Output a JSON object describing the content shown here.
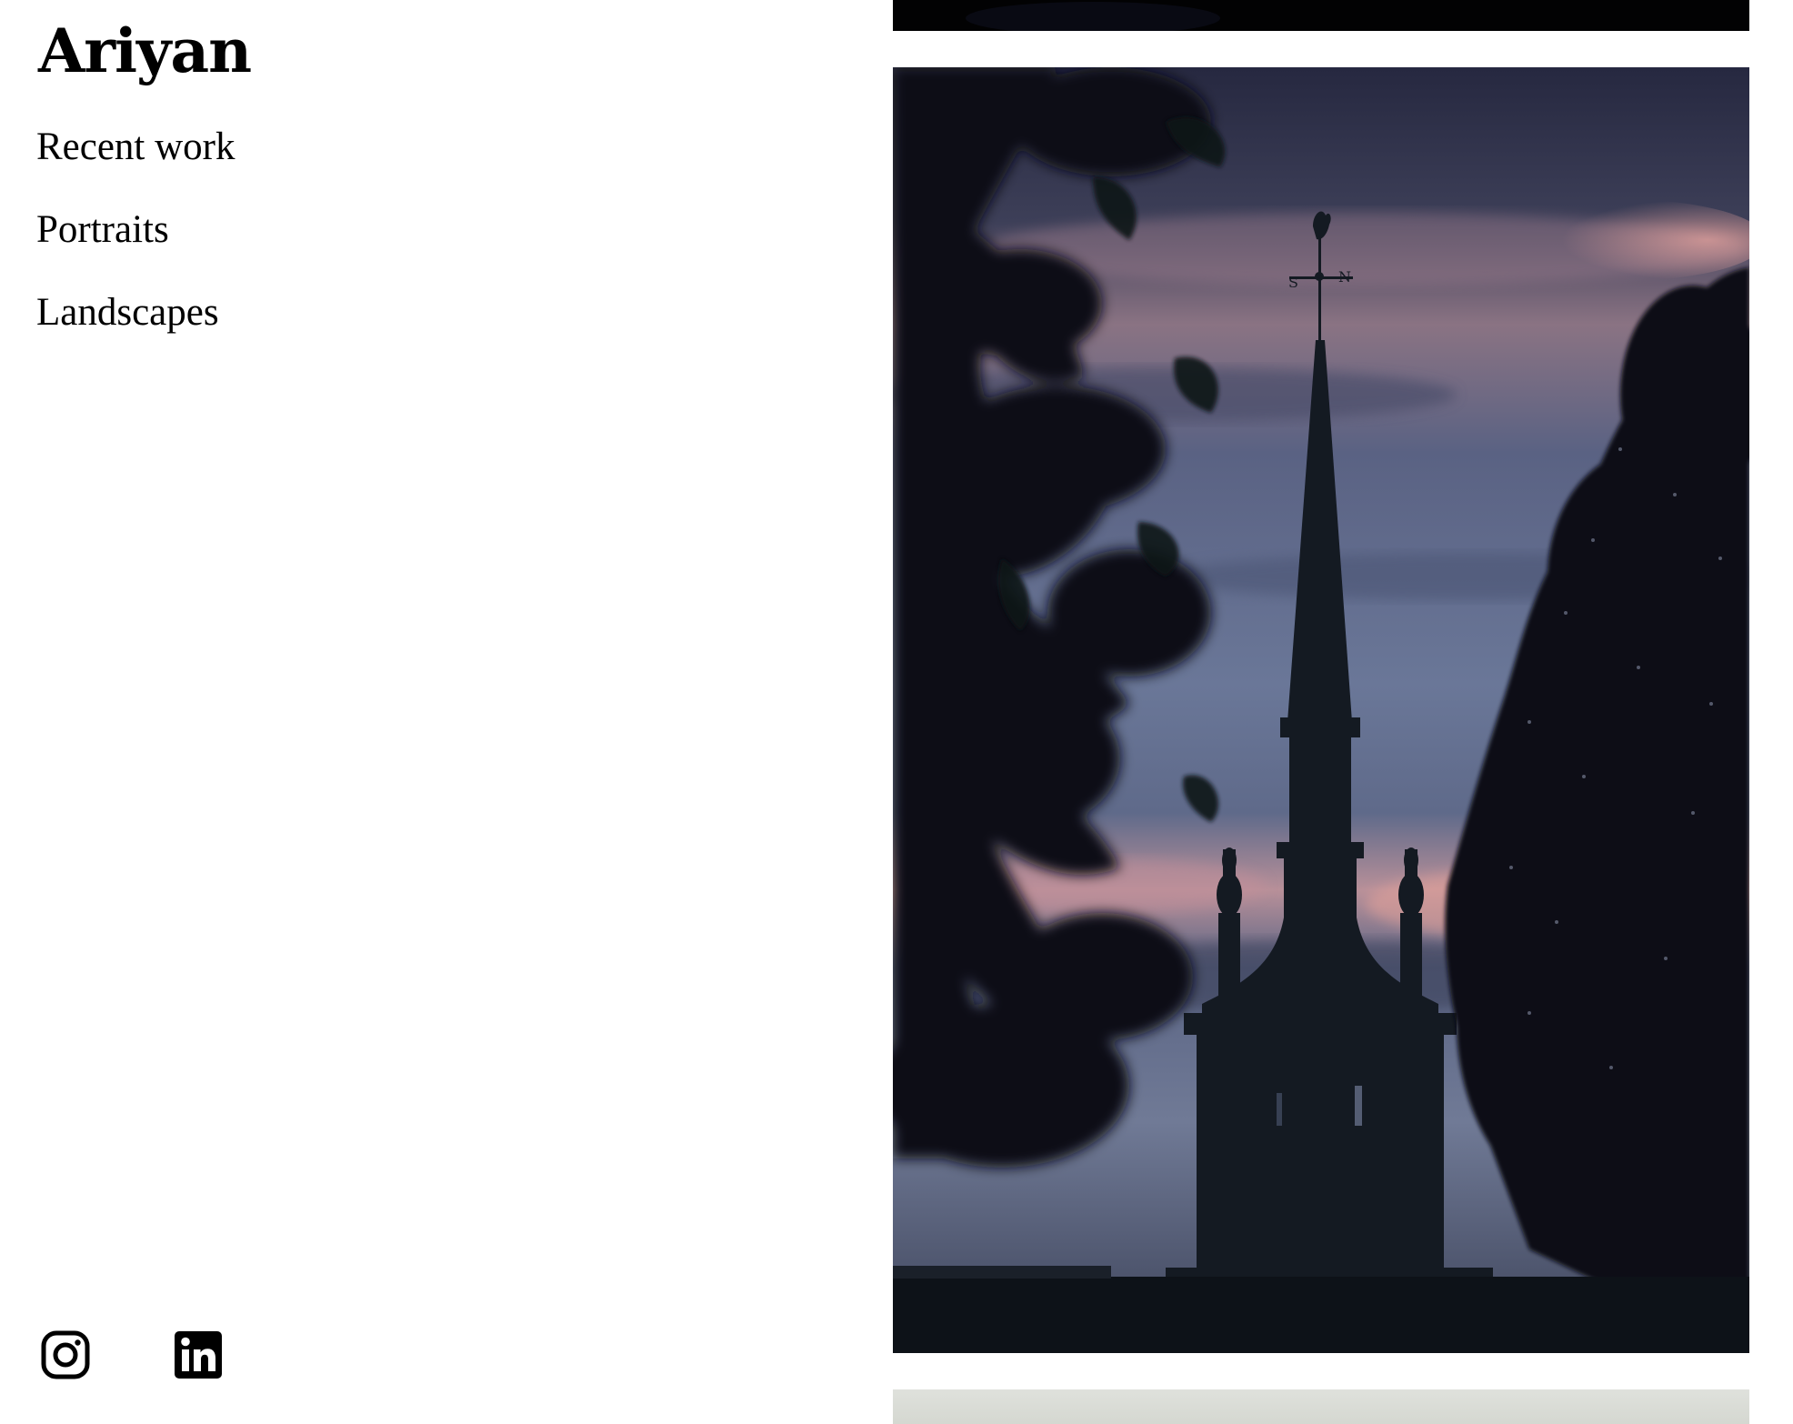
{
  "site": {
    "title": "Ariyan"
  },
  "nav": {
    "items": [
      {
        "label": "Recent work"
      },
      {
        "label": "Portraits"
      },
      {
        "label": "Landscapes"
      }
    ]
  },
  "social": {
    "items": [
      {
        "icon": "instagram-icon"
      },
      {
        "icon": "linkedin-icon"
      }
    ]
  },
  "gallery": {
    "photos": [
      {
        "subject": "dark photo cropped at top"
      },
      {
        "subject": "church spire silhouette at dusk with weathervane and trees",
        "weathervane_letters": [
          "S",
          "N"
        ]
      },
      {
        "subject": "pale grey photo cropped at bottom"
      }
    ]
  },
  "colors": {
    "background": "#ffffff",
    "text": "#000000",
    "sky_top": "#2c2f44",
    "sky_mid": "#5d6580",
    "sky_pink": "#c79aa4",
    "silhouette": "#0f141a"
  }
}
